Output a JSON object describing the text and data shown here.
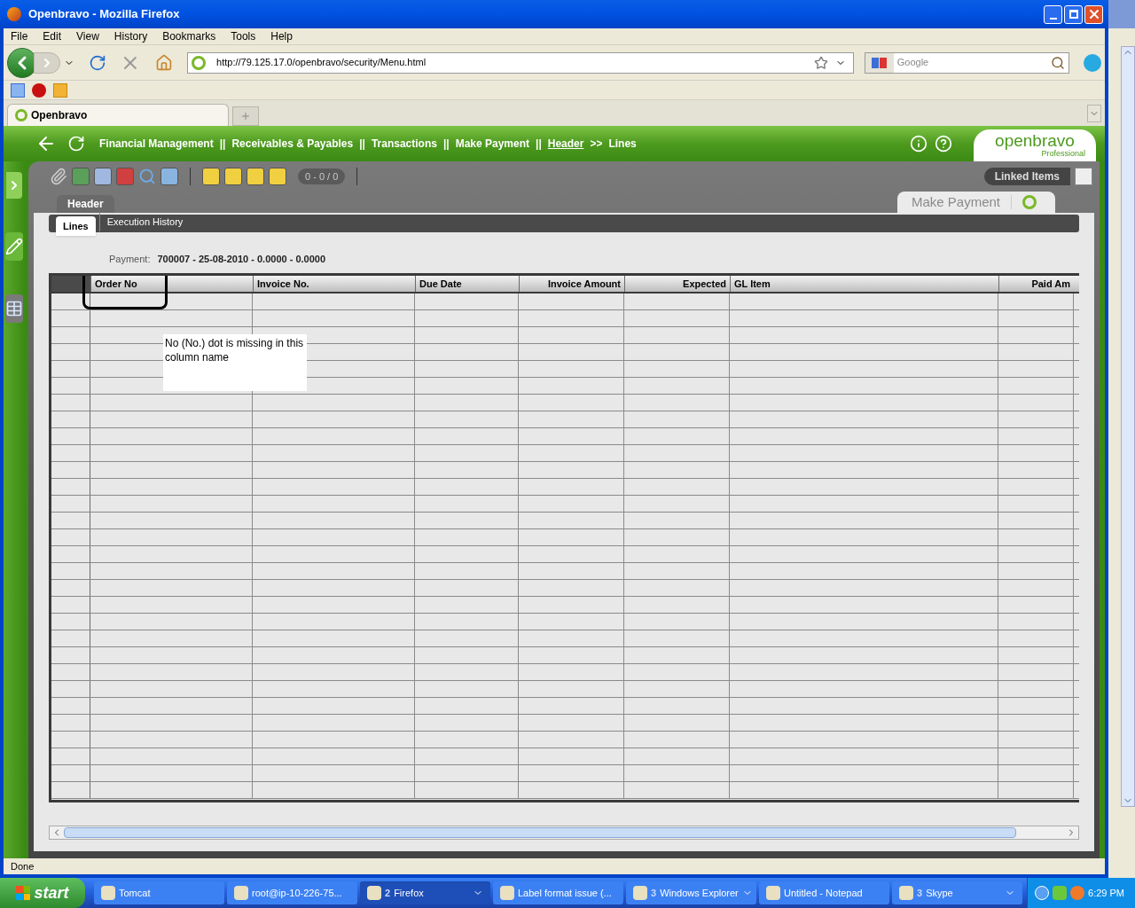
{
  "window": {
    "title": "Openbravo - Mozilla Firefox"
  },
  "menu": [
    "File",
    "Edit",
    "View",
    "History",
    "Bookmarks",
    "Tools",
    "Help"
  ],
  "navigation": {
    "url": "http://79.125.17.0/openbravo/security/Menu.html",
    "search_placeholder": "Google"
  },
  "browser_tabs": [
    {
      "label": "Openbravo",
      "selected": true
    }
  ],
  "breadcrumb": [
    {
      "kind": "crumb",
      "text": "Financial Management"
    },
    {
      "kind": "sep",
      "text": "||"
    },
    {
      "kind": "crumb",
      "text": "Receivables & Payables"
    },
    {
      "kind": "sep",
      "text": "||"
    },
    {
      "kind": "crumb",
      "text": "Transactions"
    },
    {
      "kind": "sep",
      "text": "||"
    },
    {
      "kind": "crumb",
      "text": "Make Payment"
    },
    {
      "kind": "sep",
      "text": "||"
    },
    {
      "kind": "link",
      "text": "Header"
    },
    {
      "kind": "sep",
      "text": ">>"
    },
    {
      "kind": "crumb",
      "text": "Lines"
    }
  ],
  "logo": {
    "name": "openbravo",
    "edition": "Professional"
  },
  "toolbar": {
    "record_counter": "0 - 0 / 0",
    "linked_items": "Linked Items"
  },
  "window_tab": {
    "title": "Make Payment"
  },
  "level1_tabs": [
    {
      "label": "Header",
      "selected": true
    }
  ],
  "level2_tabs": [
    {
      "label": "Lines",
      "selected": true
    },
    {
      "label": "Execution History",
      "selected": false
    }
  ],
  "payment": {
    "label": "Payment:",
    "value": "700007 - 25-08-2010 - 0.0000 - 0.0000"
  },
  "table": {
    "columns": [
      {
        "label": "Order No",
        "numeric": false
      },
      {
        "label": "Invoice No.",
        "numeric": false
      },
      {
        "label": "Due Date",
        "numeric": false
      },
      {
        "label": "Invoice Amount",
        "numeric": true
      },
      {
        "label": "Expected",
        "numeric": true
      },
      {
        "label": "GL Item",
        "numeric": false
      },
      {
        "label": "Paid Am",
        "numeric": true
      }
    ]
  },
  "annotation": {
    "note": "No (No.) dot is missing in this column name"
  },
  "status_bar": {
    "text": "Done"
  },
  "taskbar": {
    "start": "start",
    "items": [
      {
        "text": "Tomcat",
        "selected": false,
        "dropdown": false
      },
      {
        "text": "root@ip-10-226-75...",
        "selected": false,
        "dropdown": false
      },
      {
        "count": "2",
        "text": "Firefox",
        "selected": true,
        "dropdown": true
      },
      {
        "text": "Label format issue (...",
        "selected": false,
        "dropdown": false
      },
      {
        "count": "3",
        "text": "Windows Explorer",
        "selected": false,
        "dropdown": true
      },
      {
        "text": "Untitled - Notepad",
        "selected": false,
        "dropdown": false
      },
      {
        "count": "3",
        "text": "Skype",
        "selected": false,
        "dropdown": true
      }
    ],
    "clock": "6:29 PM"
  }
}
